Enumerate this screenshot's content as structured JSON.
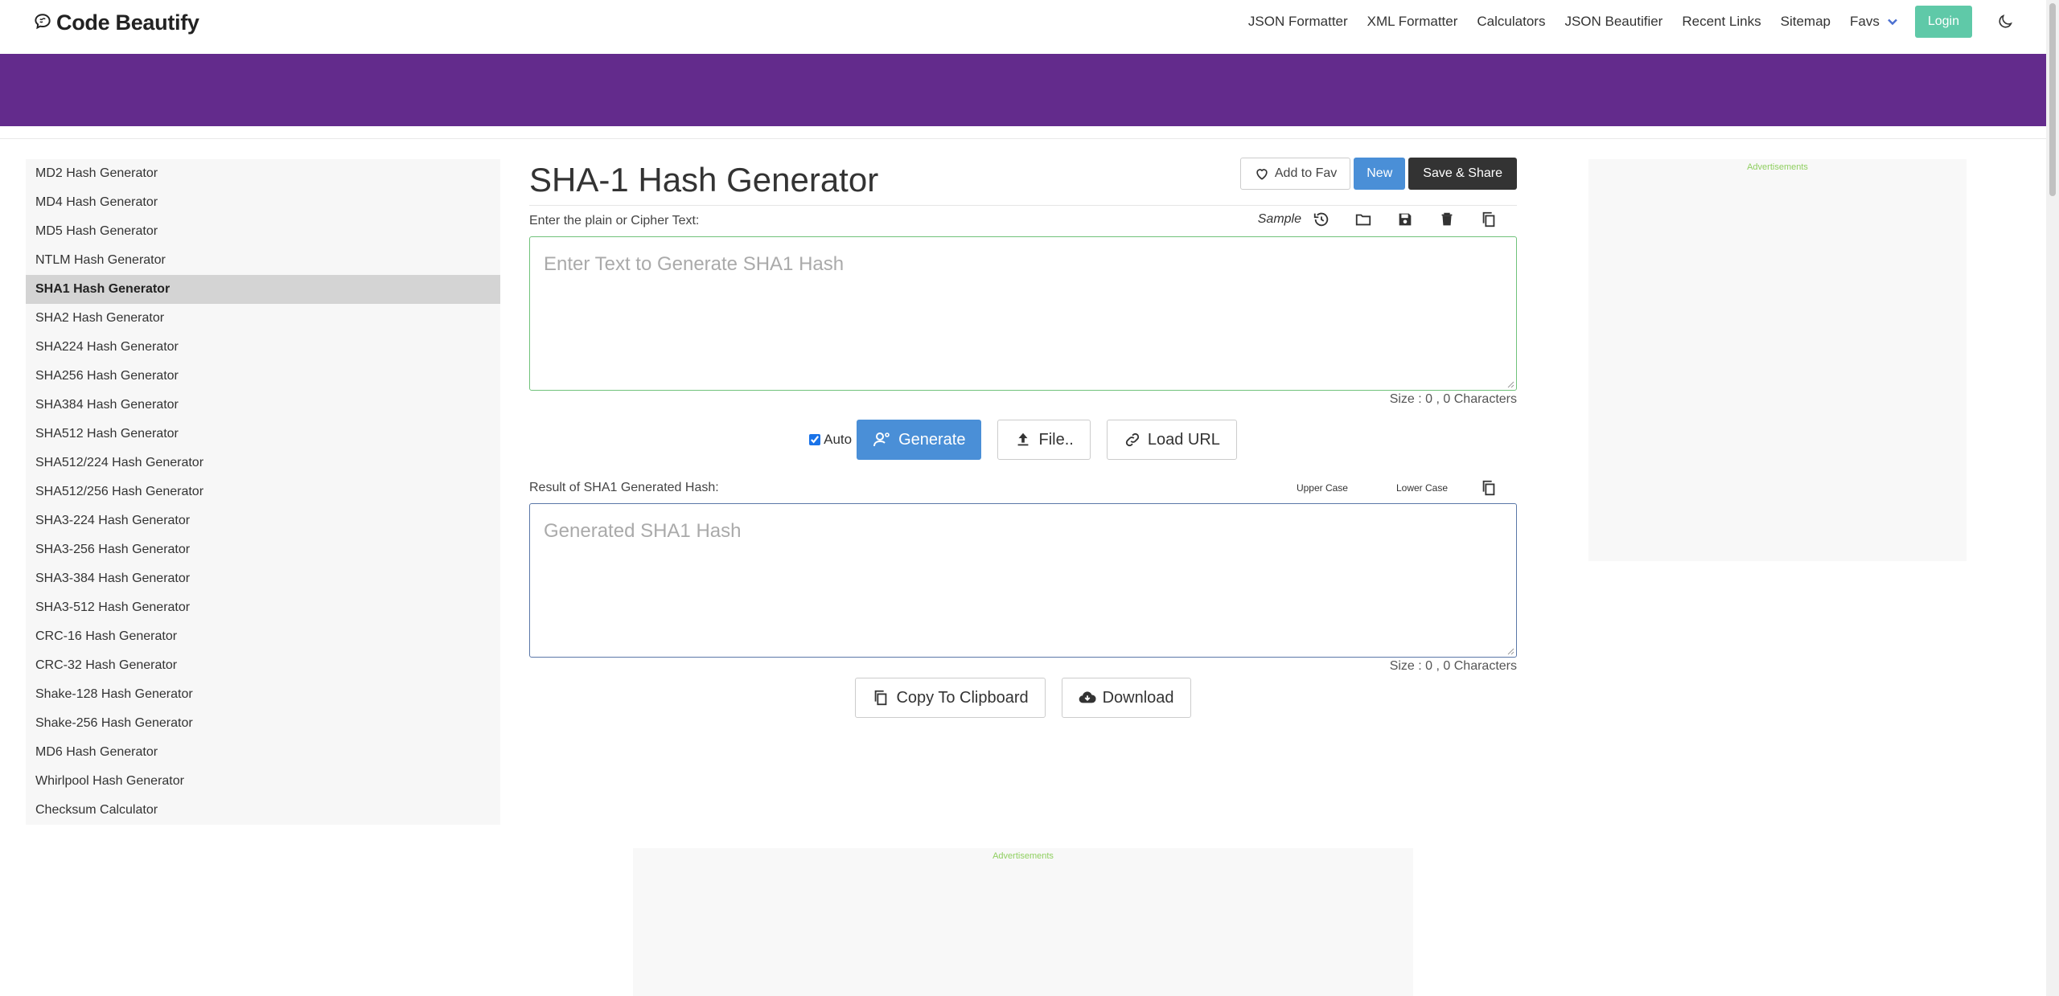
{
  "brand": {
    "name": "Code Beautify"
  },
  "nav": {
    "links": [
      "JSON Formatter",
      "XML Formatter",
      "Calculators",
      "JSON Beautifier",
      "Recent Links",
      "Sitemap"
    ],
    "favs_label": "Favs",
    "login_label": "Login"
  },
  "colors": {
    "banner": "#632b8c",
    "primary": "#4a8fd7",
    "login": "#5fc9a8",
    "active_item": "#d4d4d4"
  },
  "sidebar": {
    "items": [
      "MD2 Hash Generator",
      "MD4 Hash Generator",
      "MD5 Hash Generator",
      "NTLM Hash Generator",
      "SHA1 Hash Generator",
      "SHA2 Hash Generator",
      "SHA224 Hash Generator",
      "SHA256 Hash Generator",
      "SHA384 Hash Generator",
      "SHA512 Hash Generator",
      "SHA512/224 Hash Generator",
      "SHA512/256 Hash Generator",
      "SHA3-224 Hash Generator",
      "SHA3-256 Hash Generator",
      "SHA3-384 Hash Generator",
      "SHA3-512 Hash Generator",
      "CRC-16 Hash Generator",
      "CRC-32 Hash Generator",
      "Shake-128 Hash Generator",
      "Shake-256 Hash Generator",
      "MD6 Hash Generator",
      "Whirlpool Hash Generator",
      "Checksum Calculator"
    ],
    "active_index": 4
  },
  "main": {
    "title": "SHA-1 Hash Generator",
    "add_fav_label": "Add to Fav",
    "new_label": "New",
    "save_share_label": "Save & Share",
    "input_label": "Enter the plain or Cipher Text:",
    "sample_label": "Sample",
    "input_placeholder": "Enter Text to Generate SHA1 Hash",
    "input_size": "Size : 0 , 0 Characters",
    "auto_label": "Auto",
    "auto_checked": true,
    "generate_label": "Generate",
    "file_label": "File..",
    "load_url_label": "Load URL",
    "result_label": "Result of SHA1 Generated Hash:",
    "upper_case_label": "Upper Case",
    "lower_case_label": "Lower Case",
    "result_placeholder": "Generated SHA1 Hash",
    "result_size": "Size : 0 , 0 Characters",
    "copy_label": "Copy To Clipboard",
    "download_label": "Download"
  },
  "ads": {
    "label": "Advertisements"
  }
}
